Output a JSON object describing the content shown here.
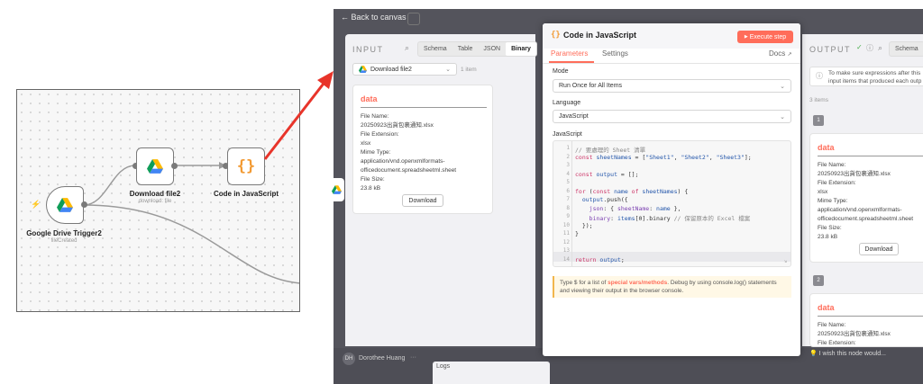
{
  "workflow": {
    "nodes": {
      "trigger": {
        "title": "Google Drive Trigger2",
        "subtitle": "fileCreated"
      },
      "download": {
        "title": "Download file2",
        "subtitle": "download: file"
      },
      "code": {
        "title": "Code in JavaScript"
      }
    }
  },
  "app": {
    "back_label": "Back to canvas",
    "input": {
      "heading": "INPUT",
      "tabs": [
        "Schema",
        "Table",
        "JSON",
        "Binary"
      ],
      "active_tab": "Binary",
      "source_select": "Download file2",
      "item_count": "1 item",
      "card": {
        "title": "data",
        "lines": [
          "File Name:",
          "20250923出貨包裹通知.xlsx",
          "File Extension:",
          "xlsx",
          "Mime Type:",
          "application/vnd.openxmlformats-",
          "officedocument.spreadsheetml.sheet",
          "File Size:",
          "23.8 kB"
        ],
        "download_label": "Download"
      }
    },
    "dialog": {
      "title": "Code in JavaScript",
      "execute_label": "Execute step",
      "tabs": {
        "parameters": "Parameters",
        "settings": "Settings"
      },
      "docs_label": "Docs",
      "mode_label": "Mode",
      "mode_value": "Run Once for All Items",
      "language_label": "Language",
      "language_value": "JavaScript",
      "code_label": "JavaScript",
      "code_lines": [
        "// 要處理的 Sheet 清單",
        "const sheetNames = [\"Sheet1\", \"Sheet2\", \"Sheet3\"];",
        "",
        "const output = [];",
        "",
        "for (const name of sheetNames) {",
        "  output.push({",
        "    json: { sheetName: name },",
        "    binary: items[0].binary // 保留原本的 Excel 檔案",
        "  });",
        "}",
        "",
        "",
        "return output;"
      ],
      "hint": {
        "prefix": "Type $ for a list of ",
        "link": "special vars/methods",
        "suffix": ". Debug by using console.log() statements and viewing their output in the browser console."
      }
    },
    "output": {
      "heading": "OUTPUT",
      "schema_tab": "Schema",
      "info": "To make sure expressions after this input items that produced each outp",
      "item_count": "3 items",
      "item1_index": "1",
      "item2_index": "2",
      "card1": {
        "title": "data",
        "lines": [
          "File Name:",
          "20250923出貨包裹通知.xlsx",
          "File Extension:",
          "xlsx",
          "Mime Type:",
          "application/vnd.openxmlformats-",
          "officedocument.spreadsheetml.sheet",
          "File Size:",
          "23.8 kB"
        ],
        "download_label": "Download"
      },
      "card2": {
        "title": "data",
        "lines": [
          "File Name:",
          "20250923出貨包裹通知.xlsx",
          "File Extension:"
        ]
      }
    },
    "footer": {
      "avatar_initials": "DH",
      "user_name": "Dorothee Huang",
      "logs_label": "Logs",
      "feedback": "I wish this node would..."
    }
  },
  "colors": {
    "accent": "#ff6d5a",
    "arrow": "#e8342a",
    "node_border": "#7a7a7a"
  }
}
